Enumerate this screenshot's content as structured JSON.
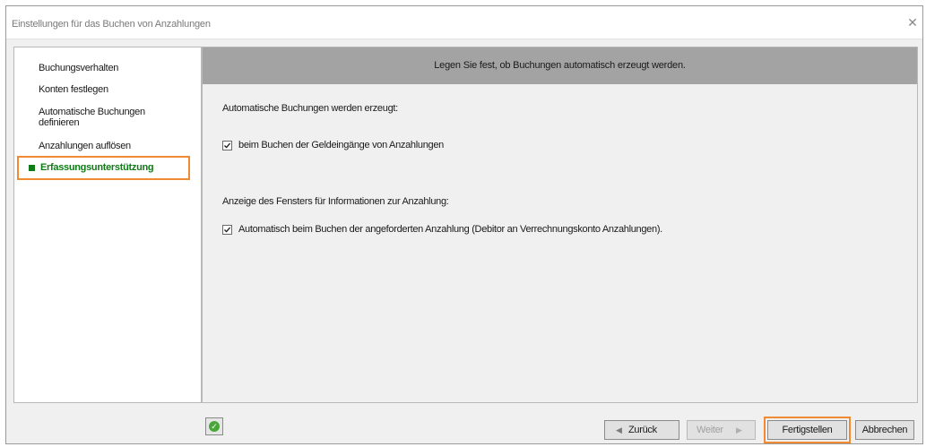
{
  "window": {
    "title": "Einstellungen für das Buchen von Anzahlungen",
    "close_glyph": "✕"
  },
  "nav": {
    "items": [
      {
        "label": "Buchungsverhalten"
      },
      {
        "label": "Konten festlegen"
      },
      {
        "label": "Automatische Buchungen\ndefinieren"
      },
      {
        "label": "Anzahlungen auflösen"
      },
      {
        "label": "Erfassungsunterstützung",
        "active": true
      }
    ],
    "active_color": "#0f7b16",
    "highlight_color": "#f08a33"
  },
  "content": {
    "header": "Legen Sie fest, ob Buchungen automatisch erzeugt werden.",
    "section1_label": "Automatische Buchungen werden erzeugt:",
    "option1": {
      "label": "beim Buchen der Geldeingänge von Anzahlungen",
      "checked": true
    },
    "section2_label": "Anzeige des Fensters für Informationen zur Anzahlung:",
    "option2": {
      "label": "Automatisch beim Buchen der angeforderten Anzahlung (Debitor an Verrechnungskonto Anzahlungen).",
      "checked": true
    }
  },
  "footer": {
    "help_icon": "help-icon",
    "back_label": "Zurück",
    "next_label": "Weiter",
    "finish_label": "Fertigstellen",
    "cancel_label": "Abbrechen"
  }
}
